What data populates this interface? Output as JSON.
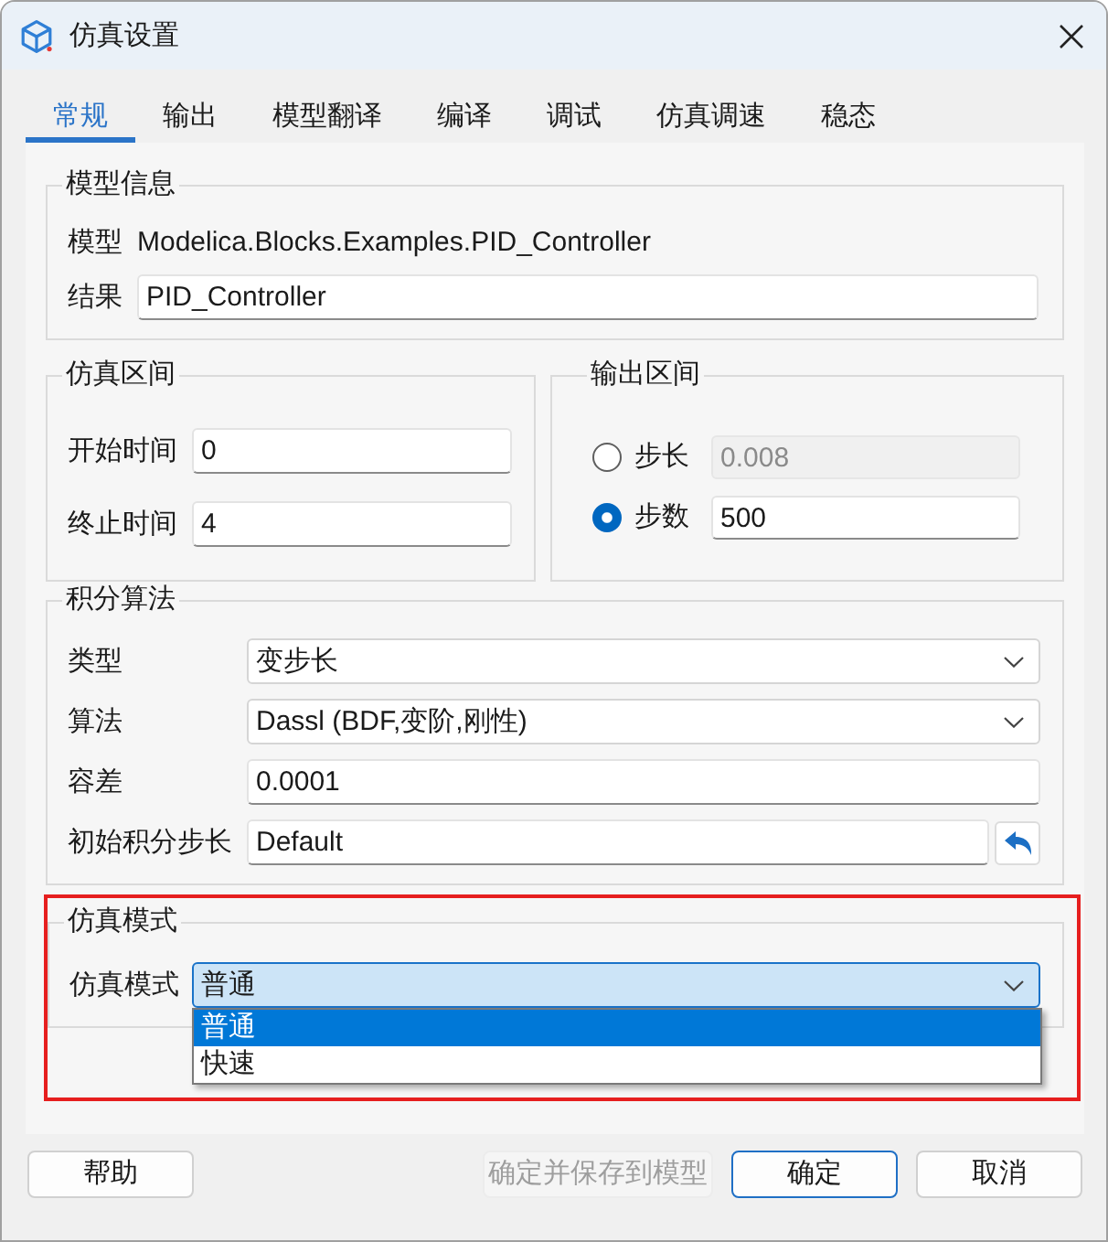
{
  "window": {
    "title": "仿真设置"
  },
  "tabs": [
    {
      "label": "常规",
      "selected": true
    },
    {
      "label": "输出",
      "selected": false
    },
    {
      "label": "模型翻译",
      "selected": false
    },
    {
      "label": "编译",
      "selected": false
    },
    {
      "label": "调试",
      "selected": false
    },
    {
      "label": "仿真调速",
      "selected": false
    },
    {
      "label": "稳态",
      "selected": false
    }
  ],
  "model_info": {
    "title": "模型信息",
    "model_label": "模型",
    "model_value": "Modelica.Blocks.Examples.PID_Controller",
    "result_label": "结果",
    "result_value": "PID_Controller"
  },
  "sim_interval": {
    "title": "仿真区间",
    "fields": [
      {
        "label": "开始时间",
        "value": "0"
      },
      {
        "label": "终止时间",
        "value": "4"
      }
    ]
  },
  "output_interval": {
    "title": "输出区间",
    "options": [
      {
        "label": "步长",
        "value": "0.008",
        "selected": false,
        "disabled": true
      },
      {
        "label": "步数",
        "value": "500",
        "selected": true,
        "disabled": false
      }
    ]
  },
  "integration": {
    "title": "积分算法",
    "rows": [
      {
        "kind": "dropdown",
        "label": "类型",
        "value": "变步长"
      },
      {
        "kind": "dropdown",
        "label": "算法",
        "value": "Dassl (BDF,变阶,刚性)"
      },
      {
        "kind": "text",
        "label": "容差",
        "value": "0.0001"
      },
      {
        "kind": "text_with_reset",
        "label": "初始积分步长",
        "value": "Default"
      }
    ]
  },
  "sim_mode": {
    "title": "仿真模式",
    "highlighted": true,
    "label": "仿真模式",
    "value": "普通",
    "expanded": true,
    "options": [
      {
        "label": "普通",
        "selected": true
      },
      {
        "label": "快速",
        "selected": false
      }
    ]
  },
  "footer": {
    "left": [
      {
        "label": "帮助",
        "disabled": false,
        "default": false
      }
    ],
    "right": [
      {
        "label": "确定并保存到模型",
        "disabled": true,
        "default": false
      },
      {
        "label": "确定",
        "disabled": false,
        "default": true
      },
      {
        "label": "取消",
        "disabled": false,
        "default": false
      }
    ]
  }
}
